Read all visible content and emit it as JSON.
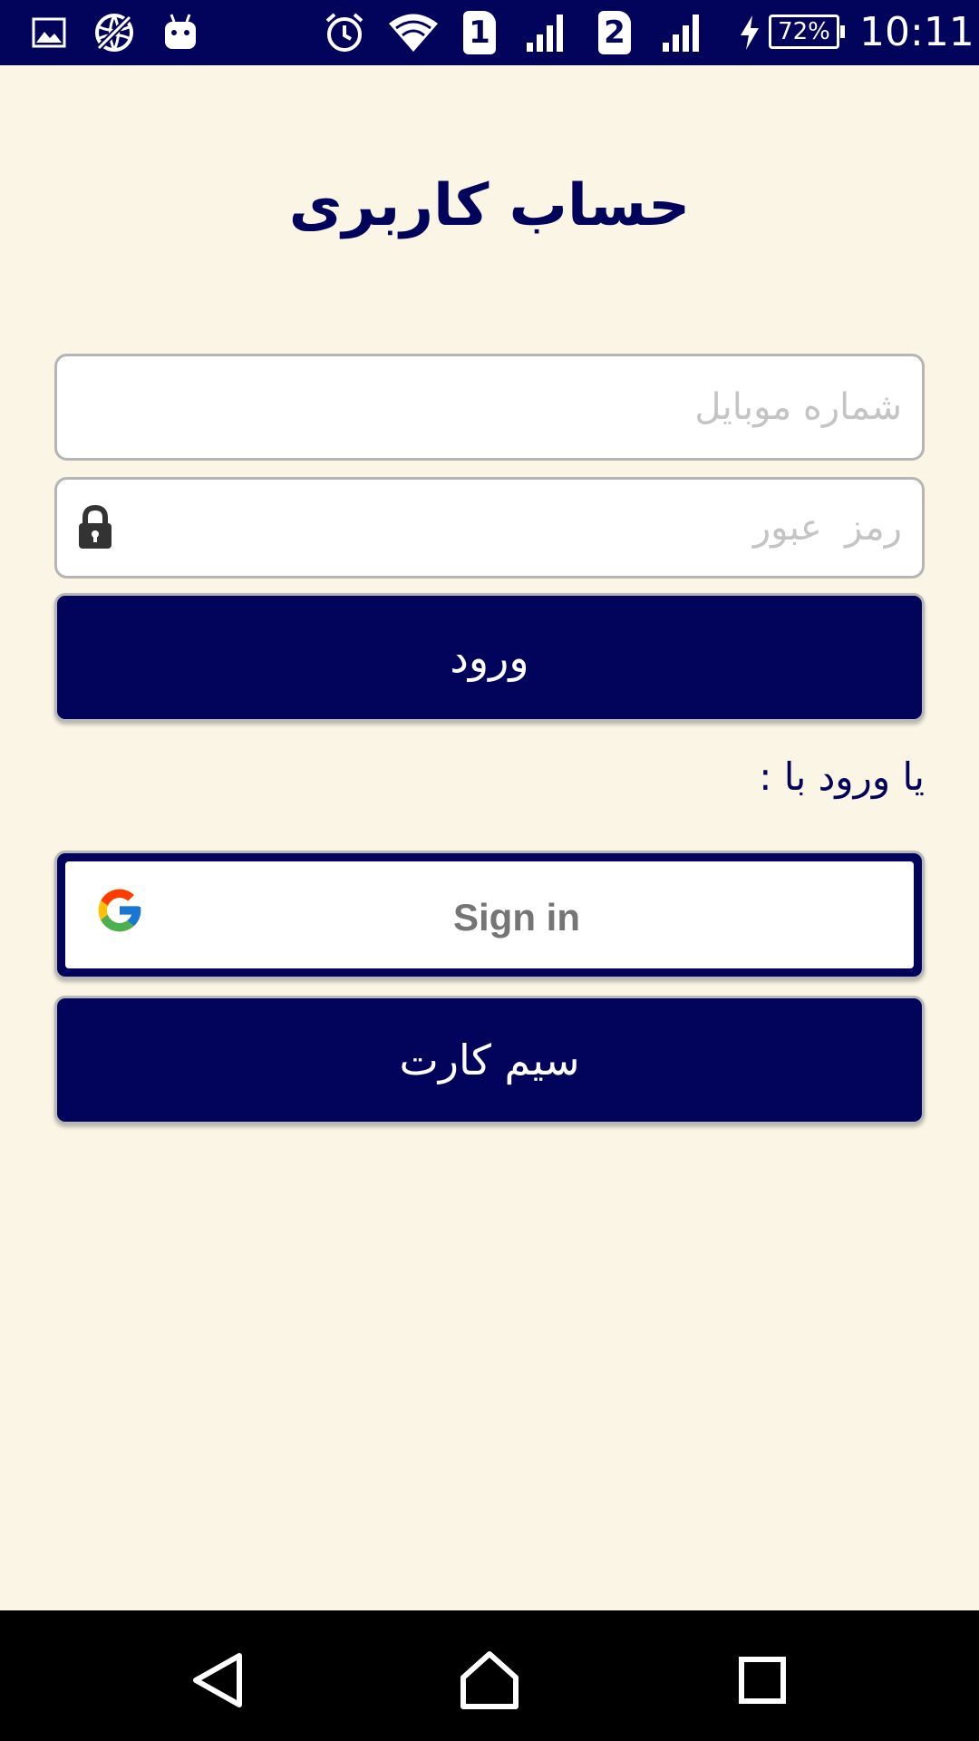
{
  "status_bar": {
    "sim1": "1",
    "sim2": "2",
    "battery": "72%",
    "time": "10:11",
    "icons": [
      "gallery-icon",
      "no-data-icon",
      "android-icon",
      "alarm-icon",
      "wifi-icon",
      "signal-icon",
      "charging-icon"
    ]
  },
  "page": {
    "title": "حساب کاربری"
  },
  "form": {
    "mobile_placeholder": "شماره موبایل",
    "password_placeholder": "رمز  عبور",
    "login_label": "ورود",
    "or_label": "یا ورود با :",
    "google_label": "Sign in",
    "simcard_label": "سیم کارت"
  },
  "colors": {
    "primary": "#02035a",
    "background": "#faf5e4",
    "input_border": "#b5b5b5",
    "placeholder": "#c4c4c4"
  }
}
